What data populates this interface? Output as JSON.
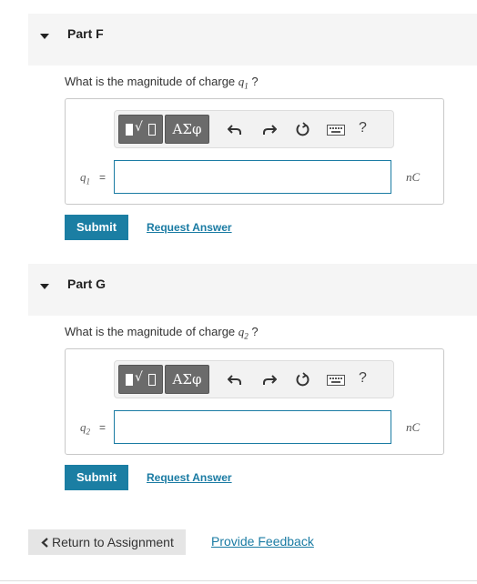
{
  "parts": [
    {
      "header": "Part F",
      "question_prefix": "What is the magnitude of charge",
      "variable": "q",
      "subscript": "1",
      "question_suffix": "?",
      "input_value": "",
      "unit": "nC",
      "submit_label": "Submit",
      "request_label": "Request Answer"
    },
    {
      "header": "Part G",
      "question_prefix": "What is the magnitude of charge",
      "variable": "q",
      "subscript": "2",
      "question_suffix": "?",
      "input_value": "",
      "unit": "nC",
      "submit_label": "Submit",
      "request_label": "Request Answer"
    }
  ],
  "toolbar": {
    "symbols_label": "ΑΣφ",
    "help_label": "?",
    "root_glyph": "√",
    "icons": [
      "templates-icon",
      "symbols-icon",
      "undo-icon",
      "redo-icon",
      "reset-icon",
      "keyboard-icon",
      "help-icon"
    ]
  },
  "equals": "=",
  "footer": {
    "return_label": "Return to Assignment",
    "feedback_label": "Provide Feedback"
  },
  "colors": {
    "accent": "#1b7ea3",
    "header_bg": "#f5f5f5",
    "toolbar_button": "#6b6b6b"
  }
}
